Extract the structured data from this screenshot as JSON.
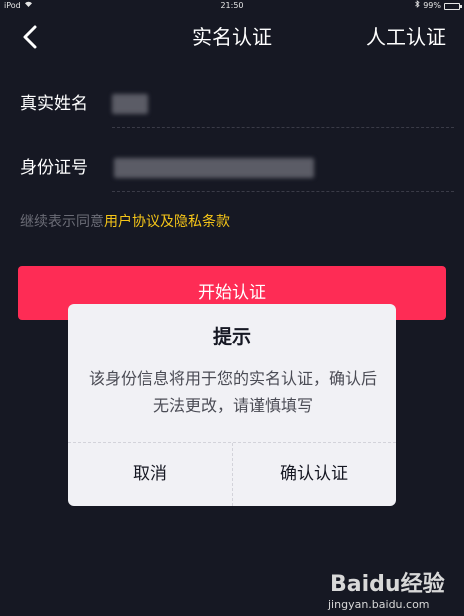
{
  "status_bar": {
    "carrier": "iPod",
    "time": "21:50",
    "battery": "99%",
    "battery_level": 0.99
  },
  "nav": {
    "title": "实名认证",
    "manual_label": "人工认证"
  },
  "form": {
    "name_label": "真实姓名",
    "id_label": "身份证号"
  },
  "agreement": {
    "prefix": "继续表示同意",
    "link": "用户协议及隐私条款"
  },
  "start_button": "开始认证",
  "dialog": {
    "title": "提示",
    "message": "该身份信息将用于您的实名认证，确认后无法更改，请谨慎填写",
    "cancel": "取消",
    "confirm": "确认认证"
  },
  "watermark": {
    "brand": "Baidu经验",
    "domain": "jingyan.baidu.com"
  },
  "colors": {
    "background": "#161823",
    "primary": "#fe2c55",
    "link": "#f5c518"
  }
}
